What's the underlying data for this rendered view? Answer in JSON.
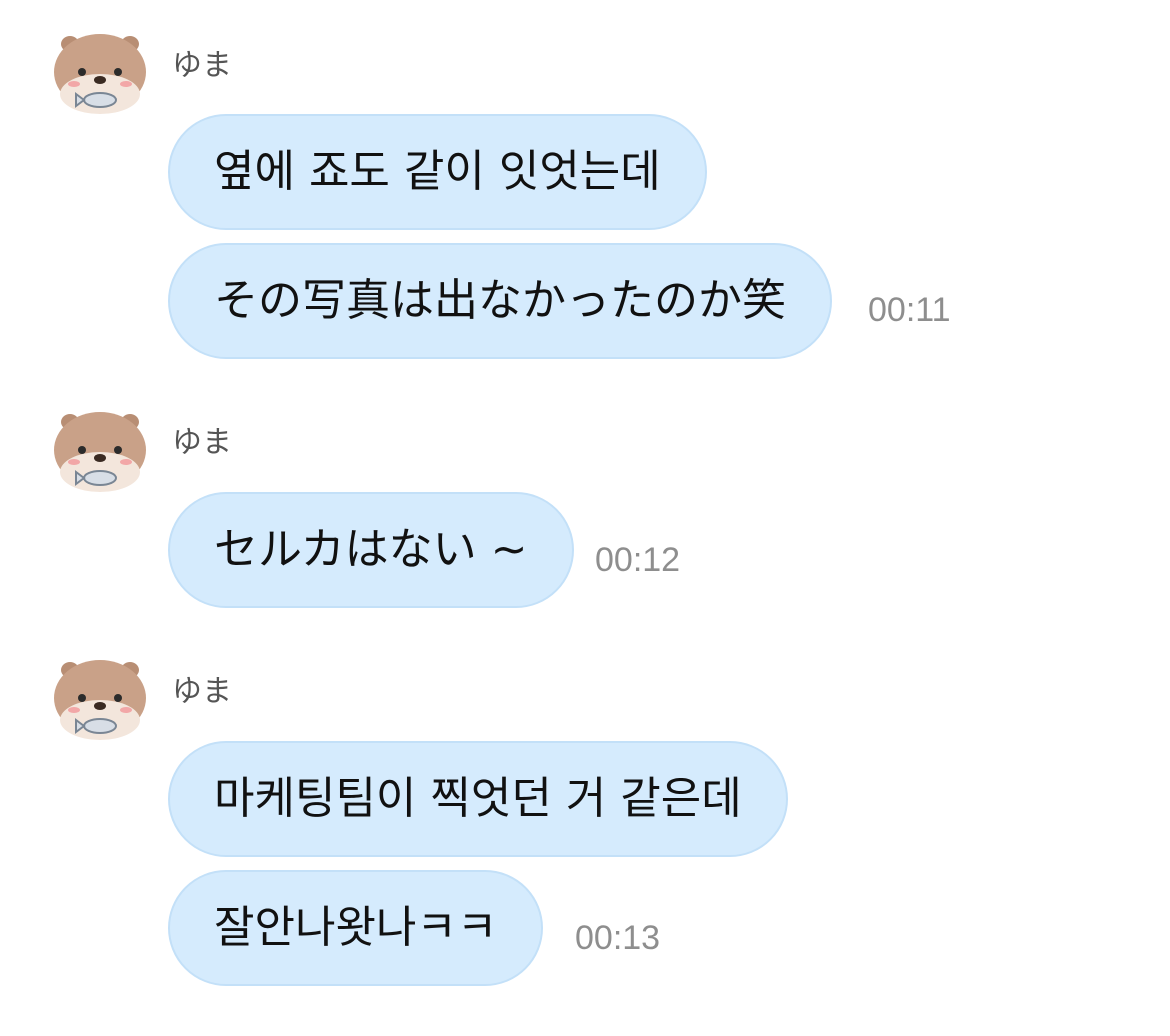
{
  "messages": [
    {
      "sender": "ゆま",
      "avatar_icon": "otter-avatar-icon",
      "bubbles": [
        "옆에 죠도 같이 잇엇는데",
        "その写真は出なかったのか笑"
      ],
      "time": "00:11"
    },
    {
      "sender": "ゆま",
      "avatar_icon": "otter-avatar-icon",
      "bubbles": [
        "セルカはない ~"
      ],
      "time": "00:12"
    },
    {
      "sender": "ゆま",
      "avatar_icon": "otter-avatar-icon",
      "bubbles": [
        "마케팅팀이 찍엇던 거 같은데",
        "잘안나왓나ㅋㅋ"
      ],
      "time": "00:13"
    }
  ],
  "colors": {
    "bubble_fill": "#d5ebfd",
    "bubble_border": "#c3e0f8",
    "name_text": "#555555",
    "time_text": "#8e8e8e",
    "avatar_fur": "#c9a188"
  }
}
